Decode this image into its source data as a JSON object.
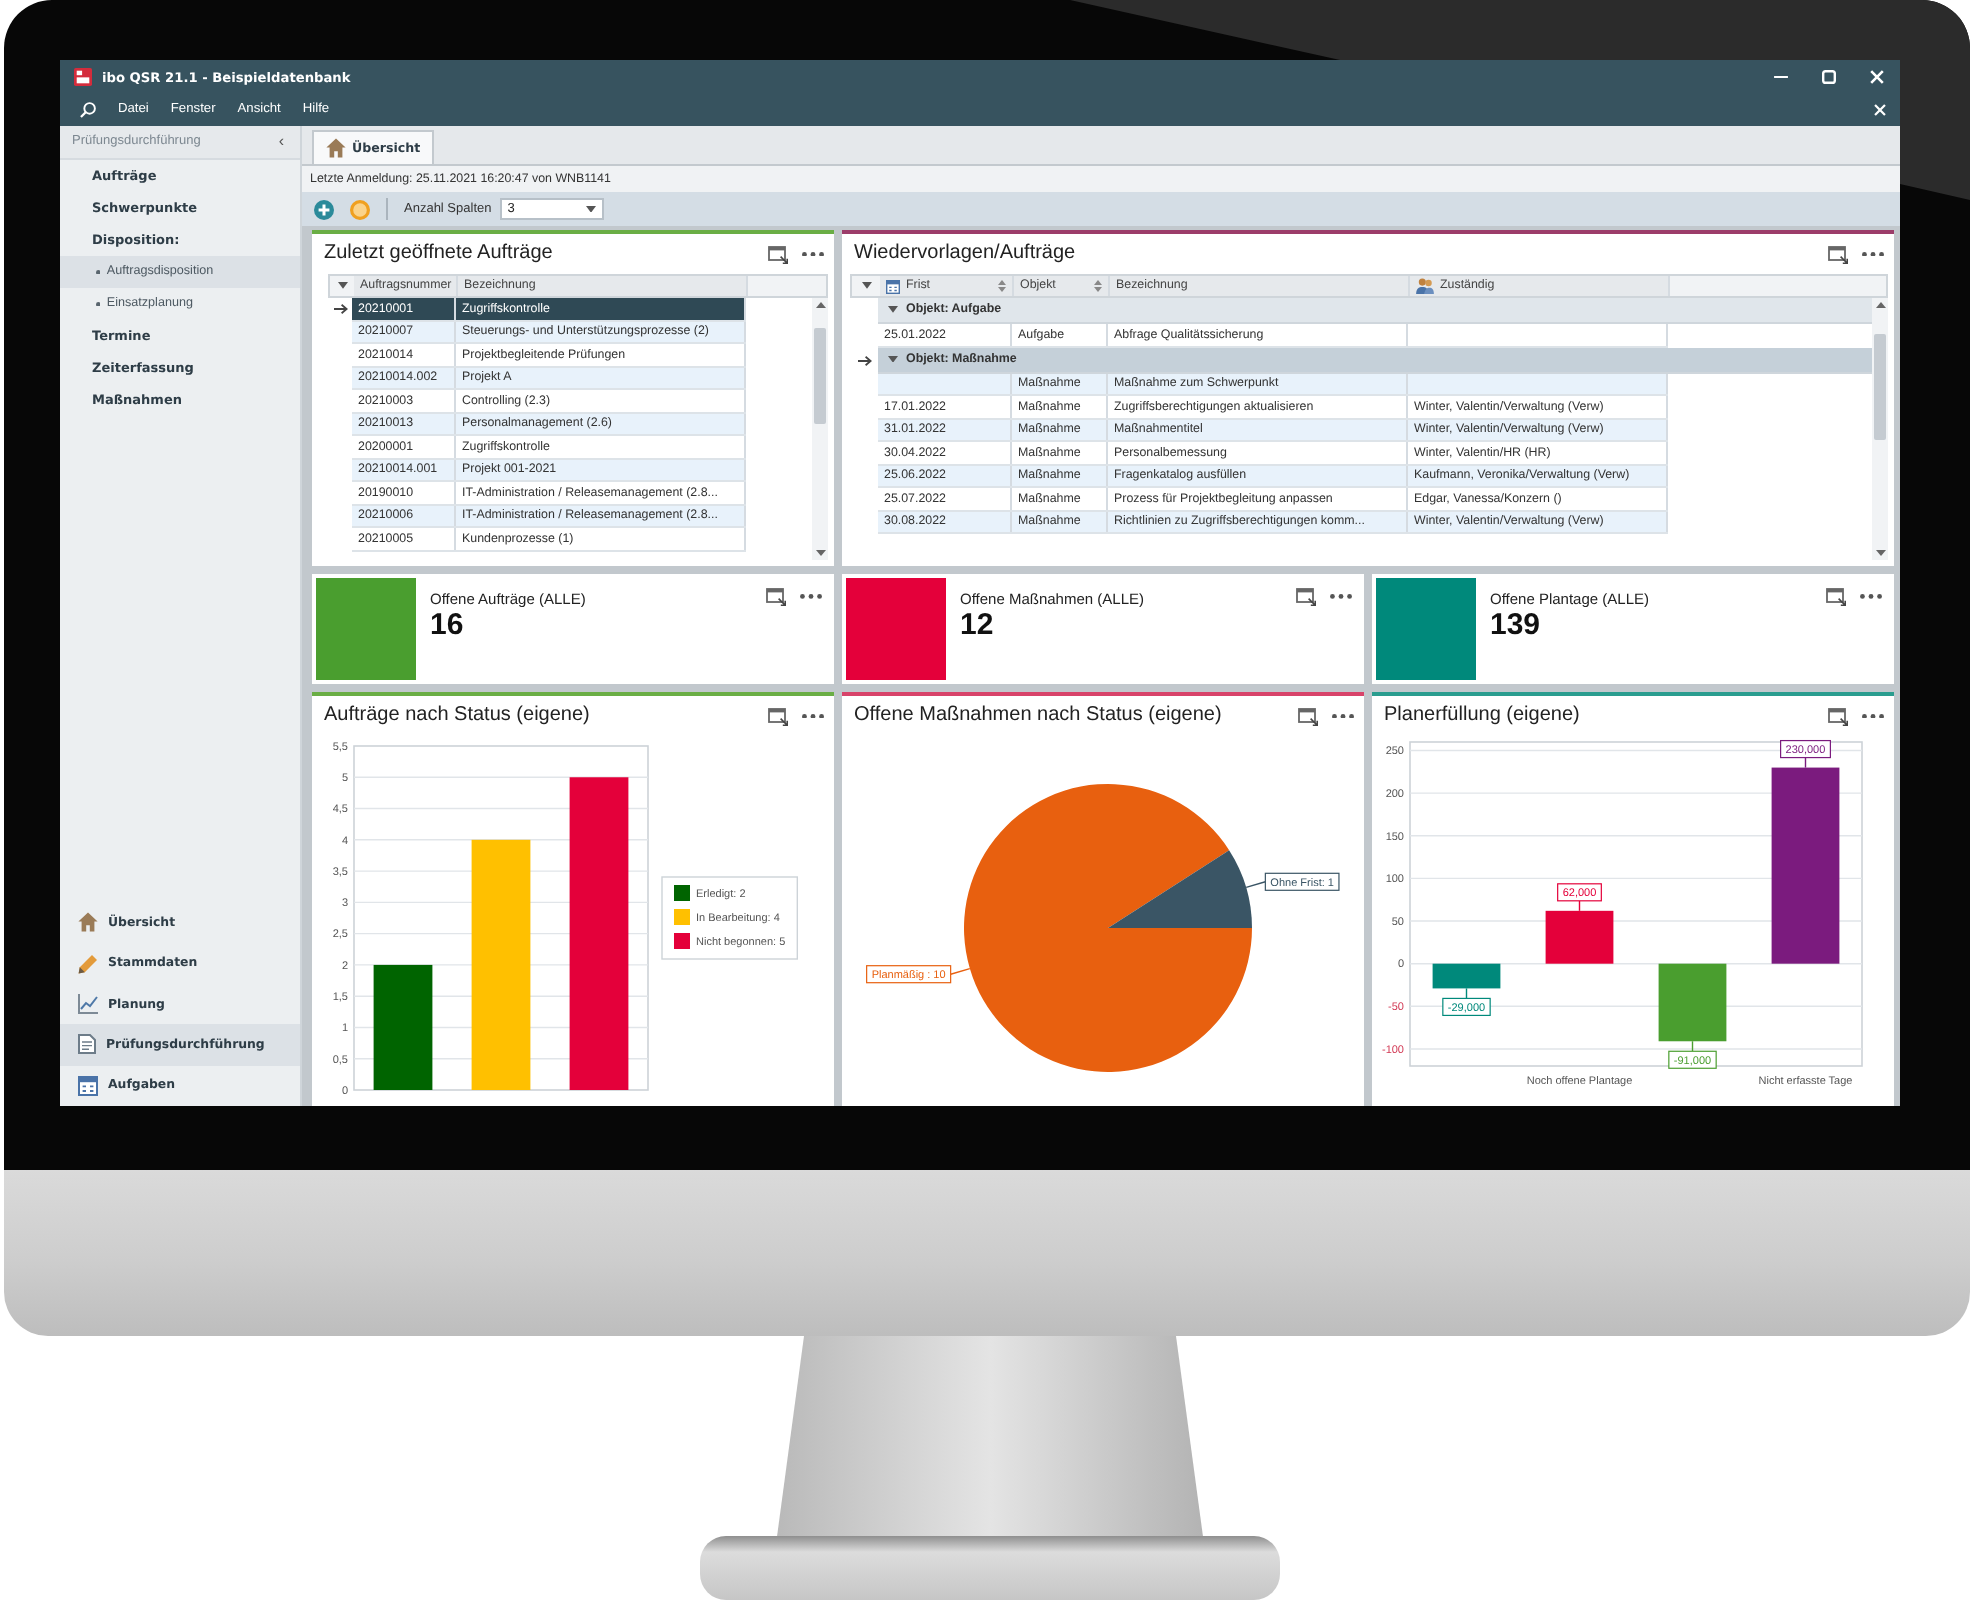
{
  "window": {
    "title": "ibo QSR 21.1 - Beispieldatenbank"
  },
  "menu": [
    "Datei",
    "Fenster",
    "Ansicht",
    "Hilfe"
  ],
  "sidebar": {
    "header": "Prüfungsdurchführung",
    "collapse_glyph": "‹",
    "items": [
      {
        "label": "Aufträge",
        "selected": false
      },
      {
        "label": "Schwerpunkte",
        "selected": false
      },
      {
        "label": "Disposition:",
        "selected": false,
        "children": [
          {
            "label": "Auftragsdisposition",
            "selected": true
          },
          {
            "label": "Einsatzplanung",
            "selected": false
          }
        ]
      },
      {
        "label": "Termine",
        "selected": false
      },
      {
        "label": "Zeiterfassung",
        "selected": false
      },
      {
        "label": "Maßnahmen",
        "selected": false
      }
    ]
  },
  "modules": [
    {
      "label": "Übersicht",
      "selected": false
    },
    {
      "label": "Stammdaten",
      "selected": false
    },
    {
      "label": "Planung",
      "selected": false
    },
    {
      "label": "Prüfungsdurchführung",
      "selected": true
    },
    {
      "label": "Aufgaben",
      "selected": false
    }
  ],
  "tabs": [
    {
      "label": "Übersicht",
      "selected": true
    }
  ],
  "last_login": "Letzte Anmeldung: 25.11.2021 16:20:47 von WNB1141",
  "toolbar": {
    "columns_label": "Anzahl Spalten",
    "columns_value": "3"
  },
  "recent_orders": {
    "title": "Zuletzt geöffnete Aufträge",
    "columns": [
      "Auftragsnummer",
      "Bezeichnung"
    ],
    "rows": [
      {
        "cells": [
          "20210001",
          "Zugriffskontrolle"
        ],
        "selected": true
      },
      {
        "cells": [
          "20210007",
          "Steuerungs- und Unterstützungsprozesse (2)"
        ],
        "selected": false
      },
      {
        "cells": [
          "20210014",
          "Projektbegleitende Prüfungen"
        ],
        "selected": false
      },
      {
        "cells": [
          "20210014.002",
          "Projekt A"
        ],
        "selected": false
      },
      {
        "cells": [
          "20210003",
          "Controlling (2.3)"
        ],
        "selected": false
      },
      {
        "cells": [
          "20210013",
          "Personalmanagement (2.6)"
        ],
        "selected": false
      },
      {
        "cells": [
          "20200001",
          "Zugriffskontrolle"
        ],
        "selected": false
      },
      {
        "cells": [
          "20210014.001",
          "Projekt 001-2021"
        ],
        "selected": false
      },
      {
        "cells": [
          "20190010",
          "IT-Administration / Releasemanagement (2.8..."
        ],
        "selected": false
      },
      {
        "cells": [
          "20210006",
          "IT-Administration / Releasemanagement (2.8..."
        ],
        "selected": false
      },
      {
        "cells": [
          "20210005",
          "Kundenprozesse (1)"
        ],
        "selected": false
      }
    ]
  },
  "followups": {
    "title": "Wiedervorlagen/Aufträge",
    "columns": [
      "Frist",
      "Objekt",
      "Bezeichnung",
      "Zuständig"
    ],
    "groups": [
      {
        "label": "Objekt: Aufgabe",
        "expanded": true,
        "selected": false,
        "rows": [
          {
            "cells": [
              "25.01.2022",
              "Aufgabe",
              "Abfrage Qualitätssicherung",
              null
            ],
            "selected": false
          }
        ]
      },
      {
        "label": "Objekt: Maßnahme",
        "expanded": true,
        "selected": true,
        "rows": [
          {
            "cells": [
              null,
              "Maßnahme",
              "Maßnahme zum Schwerpunkt",
              null
            ],
            "selected": false
          },
          {
            "cells": [
              "17.01.2022",
              "Maßnahme",
              "Zugriffsberechtigungen aktualisieren",
              "Winter, Valentin/Verwaltung (Verw)"
            ],
            "selected": false
          },
          {
            "cells": [
              "31.01.2022",
              "Maßnahme",
              "Maßnahmentitel",
              "Winter, Valentin/Verwaltung (Verw)"
            ],
            "selected": false
          },
          {
            "cells": [
              "30.04.2022",
              "Maßnahme",
              "Personalbemessung",
              "Winter, Valentin/HR (HR)"
            ],
            "selected": false
          },
          {
            "cells": [
              "25.06.2022",
              "Maßnahme",
              "Fragenkatalog ausfüllen",
              "Kaufmann, Veronika/Verwaltung (Verw)"
            ],
            "selected": false
          },
          {
            "cells": [
              "25.07.2022",
              "Maßnahme",
              "Prozess für Projektbegleitung anpassen",
              "Edgar, Vanessa/Konzern ()"
            ],
            "selected": false
          },
          {
            "cells": [
              "30.08.2022",
              "Maßnahme",
              "Richtlinien zu Zugriffsberechtigungen komm...",
              "Winter, Valentin/Verwaltung (Verw)"
            ],
            "selected": false
          }
        ]
      }
    ]
  },
  "tiles": [
    {
      "label": "Offene Aufträge (ALLE)",
      "value": "16",
      "color": "#4a9e2f"
    },
    {
      "label": "Offene Maßnahmen (ALLE)",
      "value": "12",
      "color": "#e4003a"
    },
    {
      "label": "Offene Plantage (ALLE)",
      "value": "139",
      "color": "#00897b"
    }
  ],
  "status_chart": {
    "title": "Aufträge nach Status (eigene)",
    "chart_data": {
      "type": "bar",
      "ylim": [
        0,
        5.5
      ],
      "yticks": [
        0,
        {
          "value": 0.5,
          "label": "0,5"
        },
        1,
        {
          "value": 1.5,
          "label": "1,5"
        },
        2,
        {
          "value": 2.5,
          "label": "2,5"
        },
        3,
        {
          "value": 3.5,
          "label": "3,5"
        },
        4,
        {
          "value": 4.5,
          "label": "4,5"
        },
        5,
        {
          "value": 5.5,
          "label": "5,5"
        }
      ],
      "grid": true,
      "legend": "right",
      "series": [
        {
          "name": "Erledigt: 2",
          "color": "#006400",
          "values": [
            2,
            null,
            null
          ]
        },
        {
          "name": "In Bearbeitung: 4",
          "color": "#ffc000",
          "values": [
            null,
            4,
            null
          ]
        },
        {
          "name": "Nicht begonnen: 5",
          "color": "#e4003a",
          "values": [
            null,
            null,
            5
          ]
        }
      ]
    }
  },
  "measures_chart": {
    "title": "Offene Maßnahmen nach Status (eigene)",
    "chart_data": {
      "type": "pie",
      "categories": [
        "Planmäßig : 10",
        "Ohne Frist: 1"
      ],
      "values": [
        10,
        1
      ],
      "colors": [
        "#e8600f",
        "#3a5565"
      ]
    }
  },
  "plan_chart": {
    "title": "Planerfüllung (eigene)",
    "chart_data": {
      "type": "bar",
      "categories": [
        null,
        "Noch offene Plantage",
        null,
        "Nicht erfasste Tage"
      ],
      "ylim": [
        -120,
        260
      ],
      "yticks": [
        -100,
        -50,
        0,
        50,
        100,
        150,
        200,
        250
      ],
      "grid": true,
      "series": [
        {
          "color": "#00897b",
          "values": [
            -29,
            null,
            null,
            null
          ]
        },
        {
          "color": "#e4003a",
          "values": [
            null,
            62,
            null,
            null
          ]
        },
        {
          "color": "#4a9e2f",
          "values": [
            null,
            null,
            -91,
            null
          ]
        },
        {
          "color": "#7b1b7e",
          "values": [
            null,
            null,
            null,
            230
          ]
        }
      ],
      "value_labels": [
        "-29,000",
        "62,000",
        "-91,000",
        "230,000"
      ]
    }
  }
}
